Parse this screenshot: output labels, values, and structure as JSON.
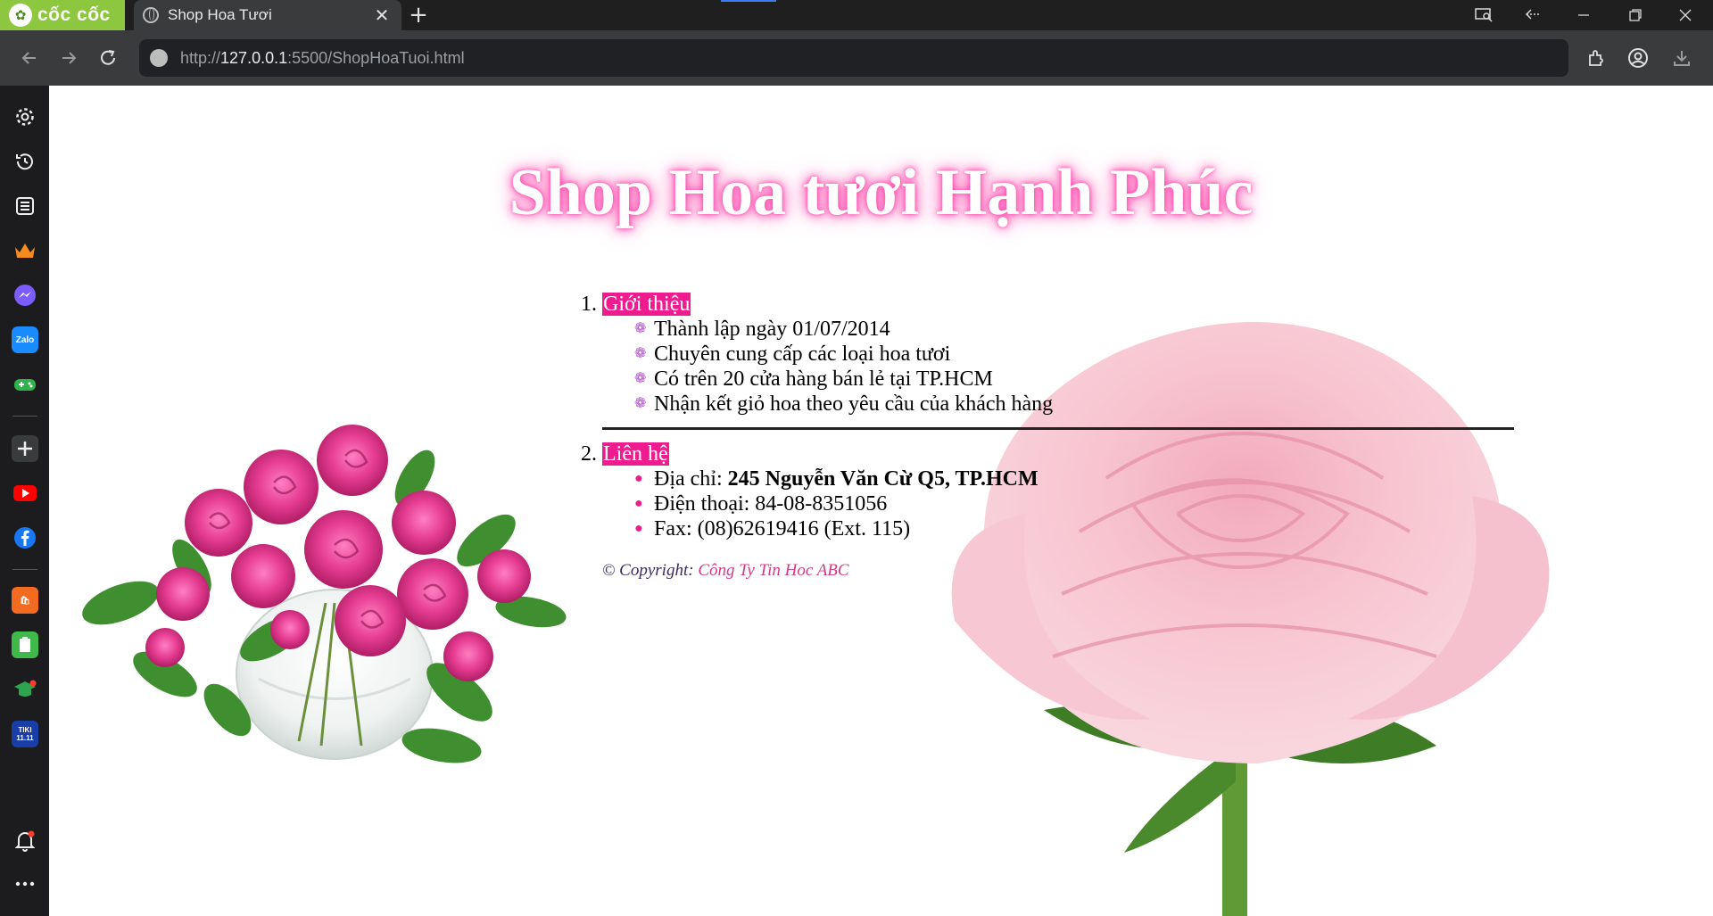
{
  "browser": {
    "brand_text": "cốc cốc",
    "tab_title": "Shop Hoa Tươi",
    "url_scheme": "http://",
    "url_host": "127.0.0.1",
    "url_rest": ":5500/ShopHoaTuoi.html"
  },
  "page": {
    "title": "Shop Hoa tươi Hạnh Phúc",
    "section1": {
      "heading": "Giới thiệu",
      "items": [
        "Thành lập ngày 01/07/2014",
        "Chuyên cung cấp các loại hoa tươi",
        "Có trên 20 cửa hàng bán lẻ tại TP.HCM",
        "Nhận kết giỏ hoa theo yêu cầu của khách hàng"
      ]
    },
    "section2": {
      "heading": "Liên hệ",
      "address_label": "Địa chỉ: ",
      "address_value": "245 Nguyễn Văn Cừ Q5, TP.HCM",
      "phone": "Điện thoại: 84-08-8351056",
      "fax": "Fax: (08)62619416 (Ext. 115)"
    },
    "copyright_label": "© Copyright: ",
    "copyright_company": "Công Ty Tin Hoc ABC"
  },
  "colors": {
    "brand_green": "#8dc63f",
    "heading_pink": "#ee1c8e",
    "title_glow": "#ff3aa7",
    "bullet_purple": "#b052c8"
  },
  "icons": {
    "sidebar": [
      "settings-icon",
      "history-icon",
      "list-icon",
      "crown-icon",
      "messenger-icon",
      "zalo-icon",
      "gamepad-icon",
      "add-icon",
      "youtube-icon",
      "facebook-icon",
      "shop-icon",
      "note-icon",
      "graduation-icon",
      "tiki-icon",
      "bell-icon",
      "more-icon"
    ]
  }
}
